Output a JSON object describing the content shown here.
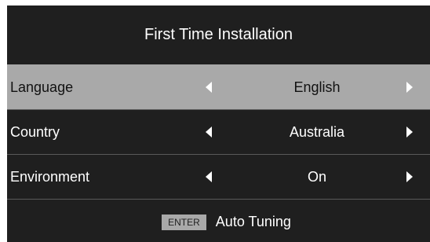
{
  "title": "First Time Installation",
  "settings": [
    {
      "label": "Language",
      "value": "English",
      "selected": true,
      "left_icon": "left-arrow",
      "right_icon": "right-arrow"
    },
    {
      "label": "Country",
      "value": "Australia",
      "selected": false,
      "left_icon": "left-arrow",
      "right_icon": "right-arrow"
    },
    {
      "label": "Environment",
      "value": "On",
      "selected": false,
      "left_icon": "left-arrow",
      "right_icon": "right-arrow"
    }
  ],
  "footer": {
    "key_label": "ENTER",
    "action_label": "Auto Tuning"
  },
  "colors": {
    "background": "#1f1f1f",
    "selected_row": "#a9a9a9",
    "text": "#ffffff"
  }
}
